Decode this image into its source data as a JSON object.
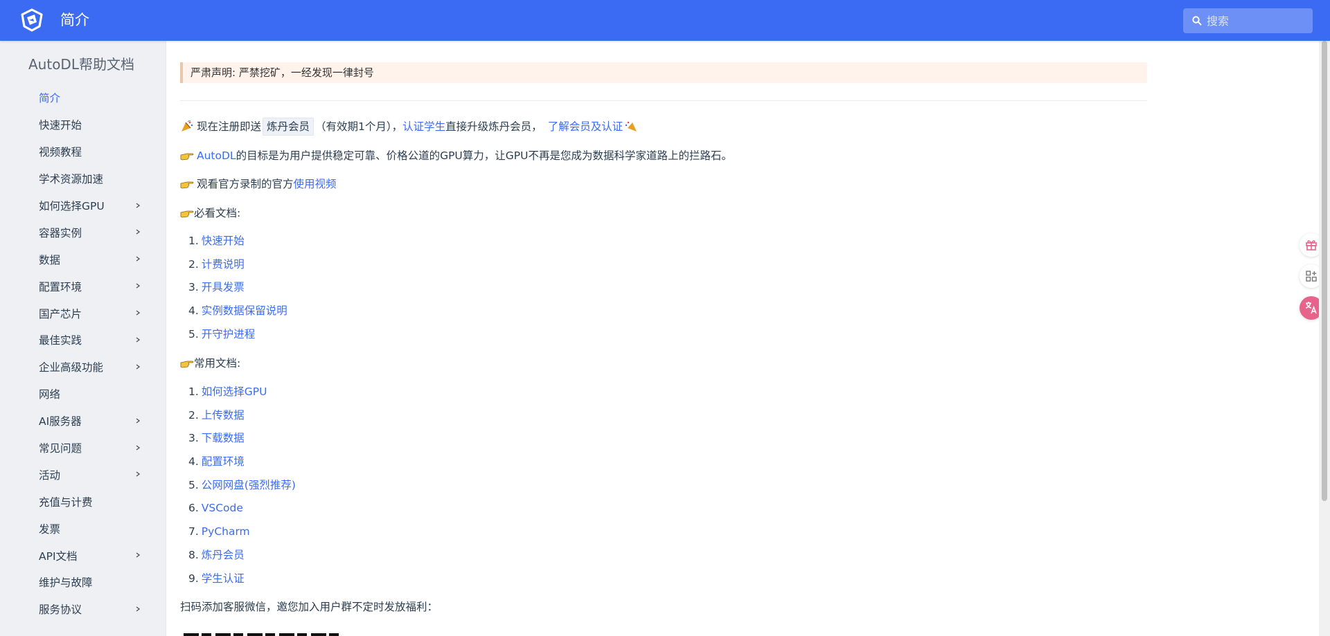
{
  "header": {
    "title": "简介",
    "search_placeholder": "搜索",
    "bg_color": "#3B6BF2"
  },
  "sidebar": {
    "title": "AutoDL帮助文档",
    "items": [
      {
        "label": "简介",
        "active": true,
        "expandable": false
      },
      {
        "label": "快速开始",
        "active": false,
        "expandable": false
      },
      {
        "label": "视频教程",
        "active": false,
        "expandable": false
      },
      {
        "label": "学术资源加速",
        "active": false,
        "expandable": false
      },
      {
        "label": "如何选择GPU",
        "active": false,
        "expandable": true
      },
      {
        "label": "容器实例",
        "active": false,
        "expandable": true
      },
      {
        "label": "数据",
        "active": false,
        "expandable": true
      },
      {
        "label": "配置环境",
        "active": false,
        "expandable": true
      },
      {
        "label": "国产芯片",
        "active": false,
        "expandable": true
      },
      {
        "label": "最佳实践",
        "active": false,
        "expandable": true
      },
      {
        "label": "企业高级功能",
        "active": false,
        "expandable": true
      },
      {
        "label": "网络",
        "active": false,
        "expandable": false
      },
      {
        "label": "AI服务器",
        "active": false,
        "expandable": true
      },
      {
        "label": "常见问题",
        "active": false,
        "expandable": true
      },
      {
        "label": "活动",
        "active": false,
        "expandable": true
      },
      {
        "label": "充值与计费",
        "active": false,
        "expandable": false
      },
      {
        "label": "发票",
        "active": false,
        "expandable": false
      },
      {
        "label": "API文档",
        "active": false,
        "expandable": true
      },
      {
        "label": "维护与故障",
        "active": false,
        "expandable": false
      },
      {
        "label": "服务协议",
        "active": false,
        "expandable": true
      }
    ]
  },
  "main": {
    "notice": "严肃声明: 严禁挖矿，一经发现一律封号",
    "promo": {
      "text1": "现在注册即送",
      "badge": "炼丹会员",
      "text2": "（有效期1个月），",
      "link1": "认证学生",
      "text3": "直接升级炼丹会员，",
      "link2": "了解会员及认证"
    },
    "goal": {
      "link": "AutoDL",
      "text": "的目标是为用户提供稳定可靠、价格公道的GPU算力，让GPU不再是您成为数据科学家道路上的拦路石。"
    },
    "video": {
      "text": "观看官方录制的官方",
      "link": "使用视频"
    },
    "must_read": {
      "heading": "必看文档:",
      "items": [
        "快速开始",
        "计费说明",
        "开具发票",
        "实例数据保留说明",
        "开守护进程"
      ]
    },
    "common": {
      "heading": "常用文档:",
      "items": [
        "如何选择GPU",
        "上传数据",
        "下载数据",
        "配置环境",
        "公网网盘(强烈推荐)",
        "VSCode",
        "PyCharm",
        "炼丹会员",
        "学生认证"
      ]
    },
    "wechat_text": "扫码添加客服微信，邀您加入用户群不定时发放福利："
  },
  "floating": {
    "icons": [
      "gift-icon",
      "apps-add-icon",
      "translate-icon"
    ],
    "accent_color": "#E8638B"
  }
}
